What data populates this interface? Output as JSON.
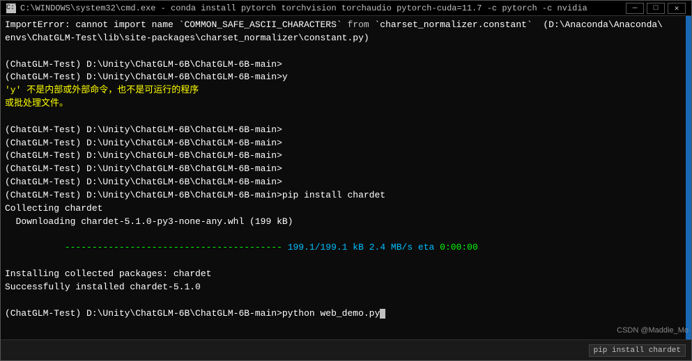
{
  "window": {
    "title": "C:\\WINDOWS\\system32\\cmd.exe - conda  install pytorch torchvision torchaudio pytorch-cuda=11.7 -c pytorch -c nvidia",
    "controls": {
      "minimize": "—",
      "maximize": "□",
      "close": "✕"
    }
  },
  "terminal": {
    "lines": [
      {
        "id": "l1",
        "text": "ImportError: cannot import name `COMMON_SAFE_ASCII_CHARACTERS` from `charset_normalizer.constant` (D:\\Anaconda\\Anaconda\\",
        "color": "white"
      },
      {
        "id": "l2",
        "text": "envs\\ChatGLM-Test\\lib\\site-packages\\charset_normalizer\\constant.py)",
        "color": "white"
      },
      {
        "id": "l3",
        "text": "",
        "color": "white"
      },
      {
        "id": "l4",
        "text": "(ChatGLM-Test) D:\\Unity\\ChatGLM-6B\\ChatGLM-6B-main>",
        "color": "white"
      },
      {
        "id": "l5",
        "text": "(ChatGLM-Test) D:\\Unity\\ChatGLM-6B\\ChatGLM-6B-main>y",
        "color": "white"
      },
      {
        "id": "l6",
        "text": "'y' 不是内部或外部命令，也不是可运行的程序",
        "color": "yellow"
      },
      {
        "id": "l7",
        "text": "或批处理文件。",
        "color": "yellow"
      },
      {
        "id": "l8",
        "text": "",
        "color": "white"
      },
      {
        "id": "l9",
        "text": "(ChatGLM-Test) D:\\Unity\\ChatGLM-6B\\ChatGLM-6B-main>",
        "color": "white"
      },
      {
        "id": "l10",
        "text": "(ChatGLM-Test) D:\\Unity\\ChatGLM-6B\\ChatGLM-6B-main>",
        "color": "white"
      },
      {
        "id": "l11",
        "text": "(ChatGLM-Test) D:\\Unity\\ChatGLM-6B\\ChatGLM-6B-main>",
        "color": "white"
      },
      {
        "id": "l12",
        "text": "(ChatGLM-Test) D:\\Unity\\ChatGLM-6B\\ChatGLM-6B-main>",
        "color": "white"
      },
      {
        "id": "l13",
        "text": "(ChatGLM-Test) D:\\Unity\\ChatGLM-6B\\ChatGLM-6B-main>",
        "color": "white"
      },
      {
        "id": "l14",
        "text": "(ChatGLM-Test) D:\\Unity\\ChatGLM-6B\\ChatGLM-6B-main>pip install chardet",
        "color": "white"
      },
      {
        "id": "l15",
        "text": "Collecting chardet",
        "color": "white"
      },
      {
        "id": "l16",
        "text": "  Downloading chardet-5.1.0-py3-none-any.whl (199 kB)",
        "color": "white"
      },
      {
        "id": "l17",
        "text": "     ---------------------------------------- 199.1/199.1 kB 2.4 MB/s eta 0:00:00",
        "color": "progress"
      },
      {
        "id": "l18",
        "text": "Installing collected packages: chardet",
        "color": "white"
      },
      {
        "id": "l19",
        "text": "Successfully installed chardet-5.1.0",
        "color": "white"
      },
      {
        "id": "l20",
        "text": "",
        "color": "white"
      },
      {
        "id": "l21",
        "text": "(ChatGLM-Test) D:\\Unity\\ChatGLM-6B\\ChatGLM-6B-main>python web_demo.py",
        "color": "white",
        "cursor": true
      }
    ]
  },
  "taskbar": {
    "items": [
      "pip install chardet"
    ],
    "watermark": "CSDN @Maddie_Mo"
  }
}
